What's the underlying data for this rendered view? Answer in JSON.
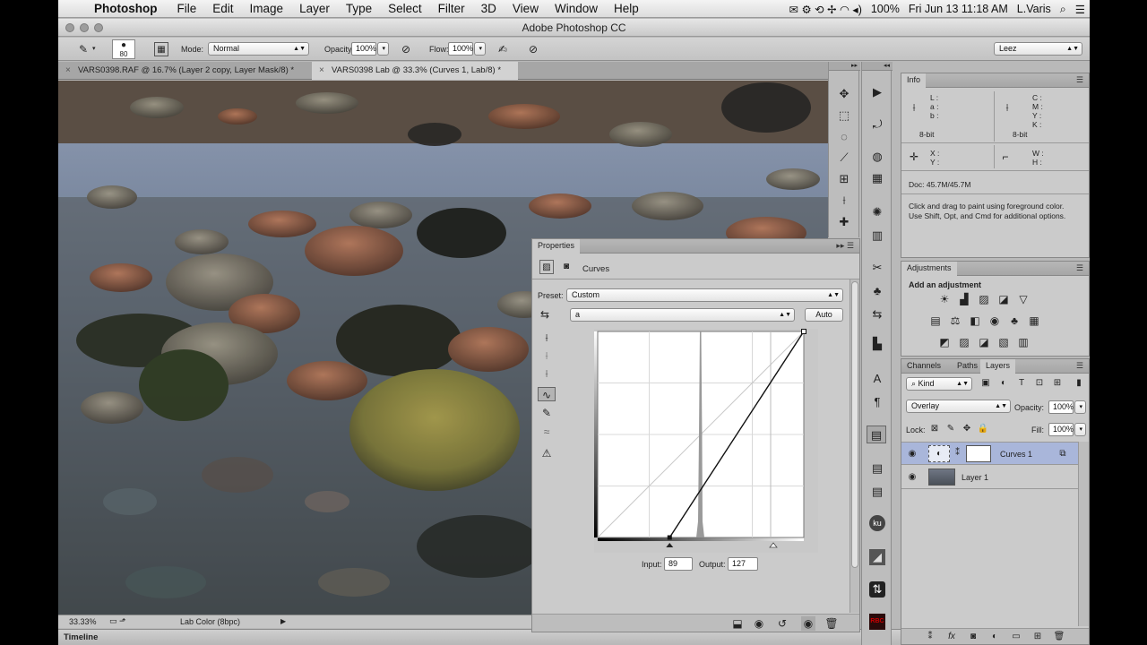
{
  "menubar": {
    "app": "Photoshop",
    "items": [
      "File",
      "Edit",
      "Image",
      "Layer",
      "Type",
      "Select",
      "Filter",
      "3D",
      "View",
      "Window",
      "Help"
    ],
    "battery": "100%",
    "datetime": "Fri Jun 13  11:18 AM",
    "user": "L.Varis"
  },
  "window": {
    "title": "Adobe Photoshop CC"
  },
  "options": {
    "brush_size": "80",
    "mode_label": "Mode:",
    "mode_value": "Normal",
    "opacity_label": "Opacity:",
    "opacity_value": "100%",
    "flow_label": "Flow:",
    "flow_value": "100%",
    "workspace": "Leez"
  },
  "doc_tabs": [
    {
      "label": "VARS0398.RAF @ 16.7% (Layer 2 copy, Layer Mask/8) *",
      "active": false
    },
    {
      "label": "VARS0398 Lab @ 33.3% (Curves 1, Lab/8) *",
      "active": true
    }
  ],
  "status": {
    "zoom": "33.33%",
    "mode": "Lab Color (8bpc)"
  },
  "timeline_label": "Timeline",
  "info_panel": {
    "tab": "Info",
    "lab_labels": [
      "L :",
      "a :",
      "b :"
    ],
    "cmyk_labels": [
      "C :",
      "M :",
      "Y :",
      "K :"
    ],
    "bit_left": "8-bit",
    "bit_right": "8-bit",
    "xy_labels": [
      "X :",
      "Y :"
    ],
    "wh_labels": [
      "W :",
      "H :"
    ],
    "doc": "Doc: 45.7M/45.7M",
    "hint_line1": "Click and drag to paint using foreground color.",
    "hint_line2": "Use Shift, Opt, and Cmd for additional options."
  },
  "adjustments_panel": {
    "tab": "Adjustments",
    "heading": "Add an adjustment"
  },
  "layers_panel": {
    "tabs": [
      "Channels",
      "Paths",
      "Layers"
    ],
    "kind": "Kind",
    "blend": "Overlay",
    "opacity_label": "Opacity:",
    "opacity_value": "100%",
    "lock_label": "Lock:",
    "fill_label": "Fill:",
    "fill_value": "100%",
    "layers": [
      {
        "name": "Curves 1",
        "selected": true
      },
      {
        "name": "Layer 1",
        "selected": false
      }
    ]
  },
  "properties_panel": {
    "tab": "Properties",
    "title": "Curves",
    "preset_label": "Preset:",
    "preset_value": "Custom",
    "channel": "a",
    "auto_label": "Auto",
    "input_label": "Input:",
    "input_value": "89",
    "output_label": "Output:",
    "output_value": "127",
    "curve_points": [
      [
        89,
        0
      ],
      [
        255,
        255
      ]
    ]
  },
  "colors": {
    "chrome": "#b9b9b9",
    "panel": "#cbcbcb",
    "selected_layer": "#a9b6da",
    "curve_bg": "#ffffff"
  }
}
